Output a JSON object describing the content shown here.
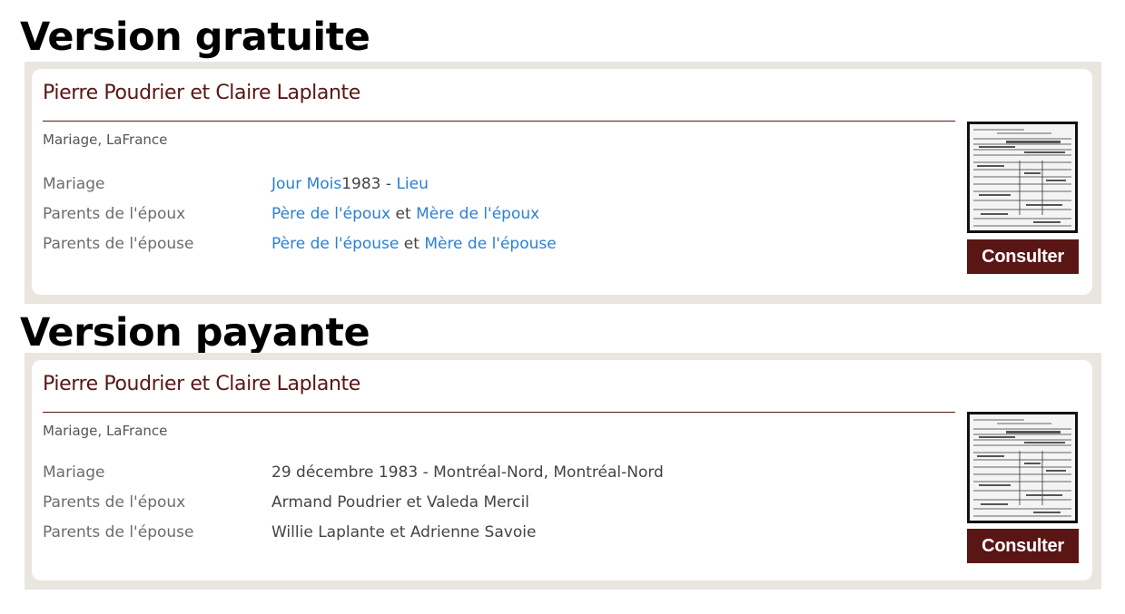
{
  "free": {
    "heading": "Version gratuite",
    "card": {
      "title": "Pierre Poudrier et Claire Laplante",
      "subtitle": "Mariage, LaFrance",
      "mariage": {
        "label": "Mariage",
        "day_month": "Jour Mois",
        "year": "1983 - ",
        "place": "Lieu"
      },
      "groom_parents": {
        "label": "Parents de l'époux",
        "father": "Père de l'époux",
        "and": " et ",
        "mother": "Mère de l'époux"
      },
      "bride_parents": {
        "label": "Parents de l'épouse",
        "father": "Père de l'épouse",
        "and": " et ",
        "mother": "Mère de l'épouse"
      },
      "button": "Consulter"
    }
  },
  "paid": {
    "heading": "Version payante",
    "card": {
      "title": "Pierre Poudrier et Claire Laplante",
      "subtitle": "Mariage, LaFrance",
      "mariage": {
        "label": "Mariage",
        "value": "29 décembre 1983 - Montréal-Nord, Montréal-Nord"
      },
      "groom_parents": {
        "label": "Parents de l'époux",
        "value": "Armand Poudrier et Valeda Mercil"
      },
      "bride_parents": {
        "label": "Parents de l'épouse",
        "value": "Willie Laplante et Adrienne Savoie"
      },
      "button": "Consulter"
    }
  },
  "colors": {
    "accent": "#5a1515",
    "link": "#2b7fd6",
    "frame": "#e9e6df"
  }
}
